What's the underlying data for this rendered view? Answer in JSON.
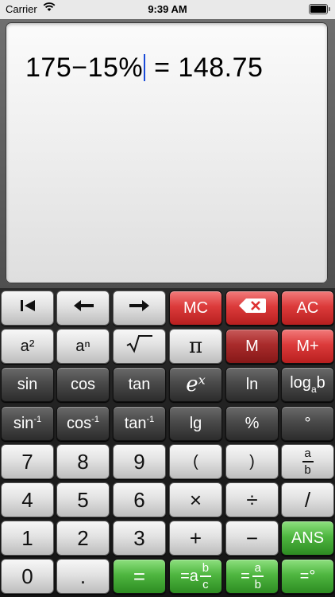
{
  "status_bar": {
    "carrier": "Carrier",
    "time": "9:39 AM",
    "wifi_icon": "wifi-icon",
    "battery_icon": "battery-icon"
  },
  "display": {
    "expression_before_cursor": "175−15%",
    "expression_after_cursor": "",
    "equals": "=",
    "result": "148.75"
  },
  "keys": {
    "row1": [
      "",
      "",
      "",
      "MC",
      "",
      "AC"
    ],
    "row2": [
      "a²",
      "aⁿ",
      "",
      "π",
      "M",
      "M+"
    ],
    "row3": [
      "sin",
      "cos",
      "tan",
      "eˣ",
      "ln",
      "log"
    ],
    "row3_log_base_a": "a",
    "row3_log_b": "b",
    "row4": [
      "sin",
      "cos",
      "tan",
      "lg",
      "%",
      "°"
    ],
    "row4_sup": "-1",
    "row5": [
      "7",
      "8",
      "9",
      "(",
      ")",
      ""
    ],
    "row5_frac_num": "a",
    "row5_frac_den": "b",
    "row6": [
      "4",
      "5",
      "6",
      "×",
      "÷",
      "/"
    ],
    "row7": [
      "1",
      "2",
      "3",
      "+",
      "−",
      "ANS"
    ],
    "row8": [
      "0",
      ".",
      "=",
      "=a",
      "=",
      "=°"
    ],
    "row8_mixed_b": "b",
    "row8_mixed_c": "c",
    "row8_frac_a": "a",
    "row8_frac_b": "b"
  },
  "colors": {
    "red_key": "#dc3b3b",
    "dark_red_key": "#a92b2b",
    "green_key": "#4fb640",
    "cursor": "#1a4bd8"
  }
}
